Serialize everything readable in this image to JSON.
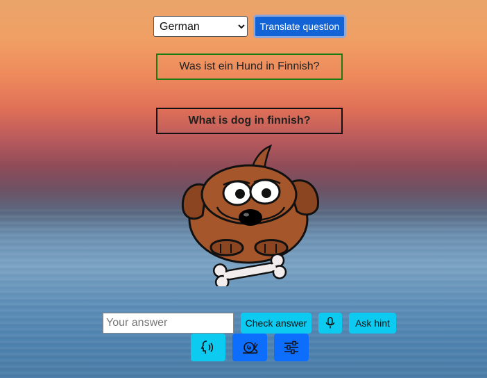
{
  "language_select": {
    "selected": "German"
  },
  "translate_button": {
    "label": "Translate question"
  },
  "question_translated": "Was ist ein Hund in Finnish?",
  "question_original": "What is dog in finnish?",
  "answer_input": {
    "placeholder": "Your answer",
    "value": ""
  },
  "check_button": {
    "label": "Check answer"
  },
  "hint_button": {
    "label": "Ask hint"
  },
  "icons": {
    "mic": "microphone-icon",
    "speak": "speaking-head-icon",
    "slow": "snail-icon",
    "settings": "sliders-icon"
  },
  "colors": {
    "primary": "#1264d6",
    "cyan": "#0dcaf0",
    "blue": "#0d6efd",
    "question_border": "#1e7a12"
  }
}
